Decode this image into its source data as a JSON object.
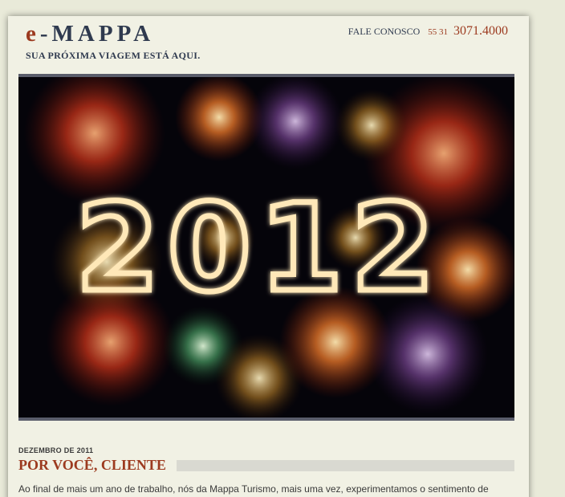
{
  "header": {
    "logo_e": "e",
    "logo_dash": "-",
    "logo_rest": "MAPPA",
    "tagline": "SUA PRÓXIMA VIAGEM ESTÁ AQUI.",
    "contact_label": "FALE CONOSCO",
    "phone_area": "55 31",
    "phone_number": "3071.4000"
  },
  "hero": {
    "year_text": "2012"
  },
  "post": {
    "date": "DEZEMBRO DE 2011",
    "title": "POR VOCÊ, CLIENTE",
    "excerpt": "Ao final de mais um ano de trabalho, nós da Mappa Turismo, mais uma vez, experimentamos o sentimento de"
  },
  "colors": {
    "accent": "#9c3a1f",
    "navy": "#2f3a4f",
    "page_bg": "#e9ead9",
    "panel_bg": "#f1f1e4"
  }
}
